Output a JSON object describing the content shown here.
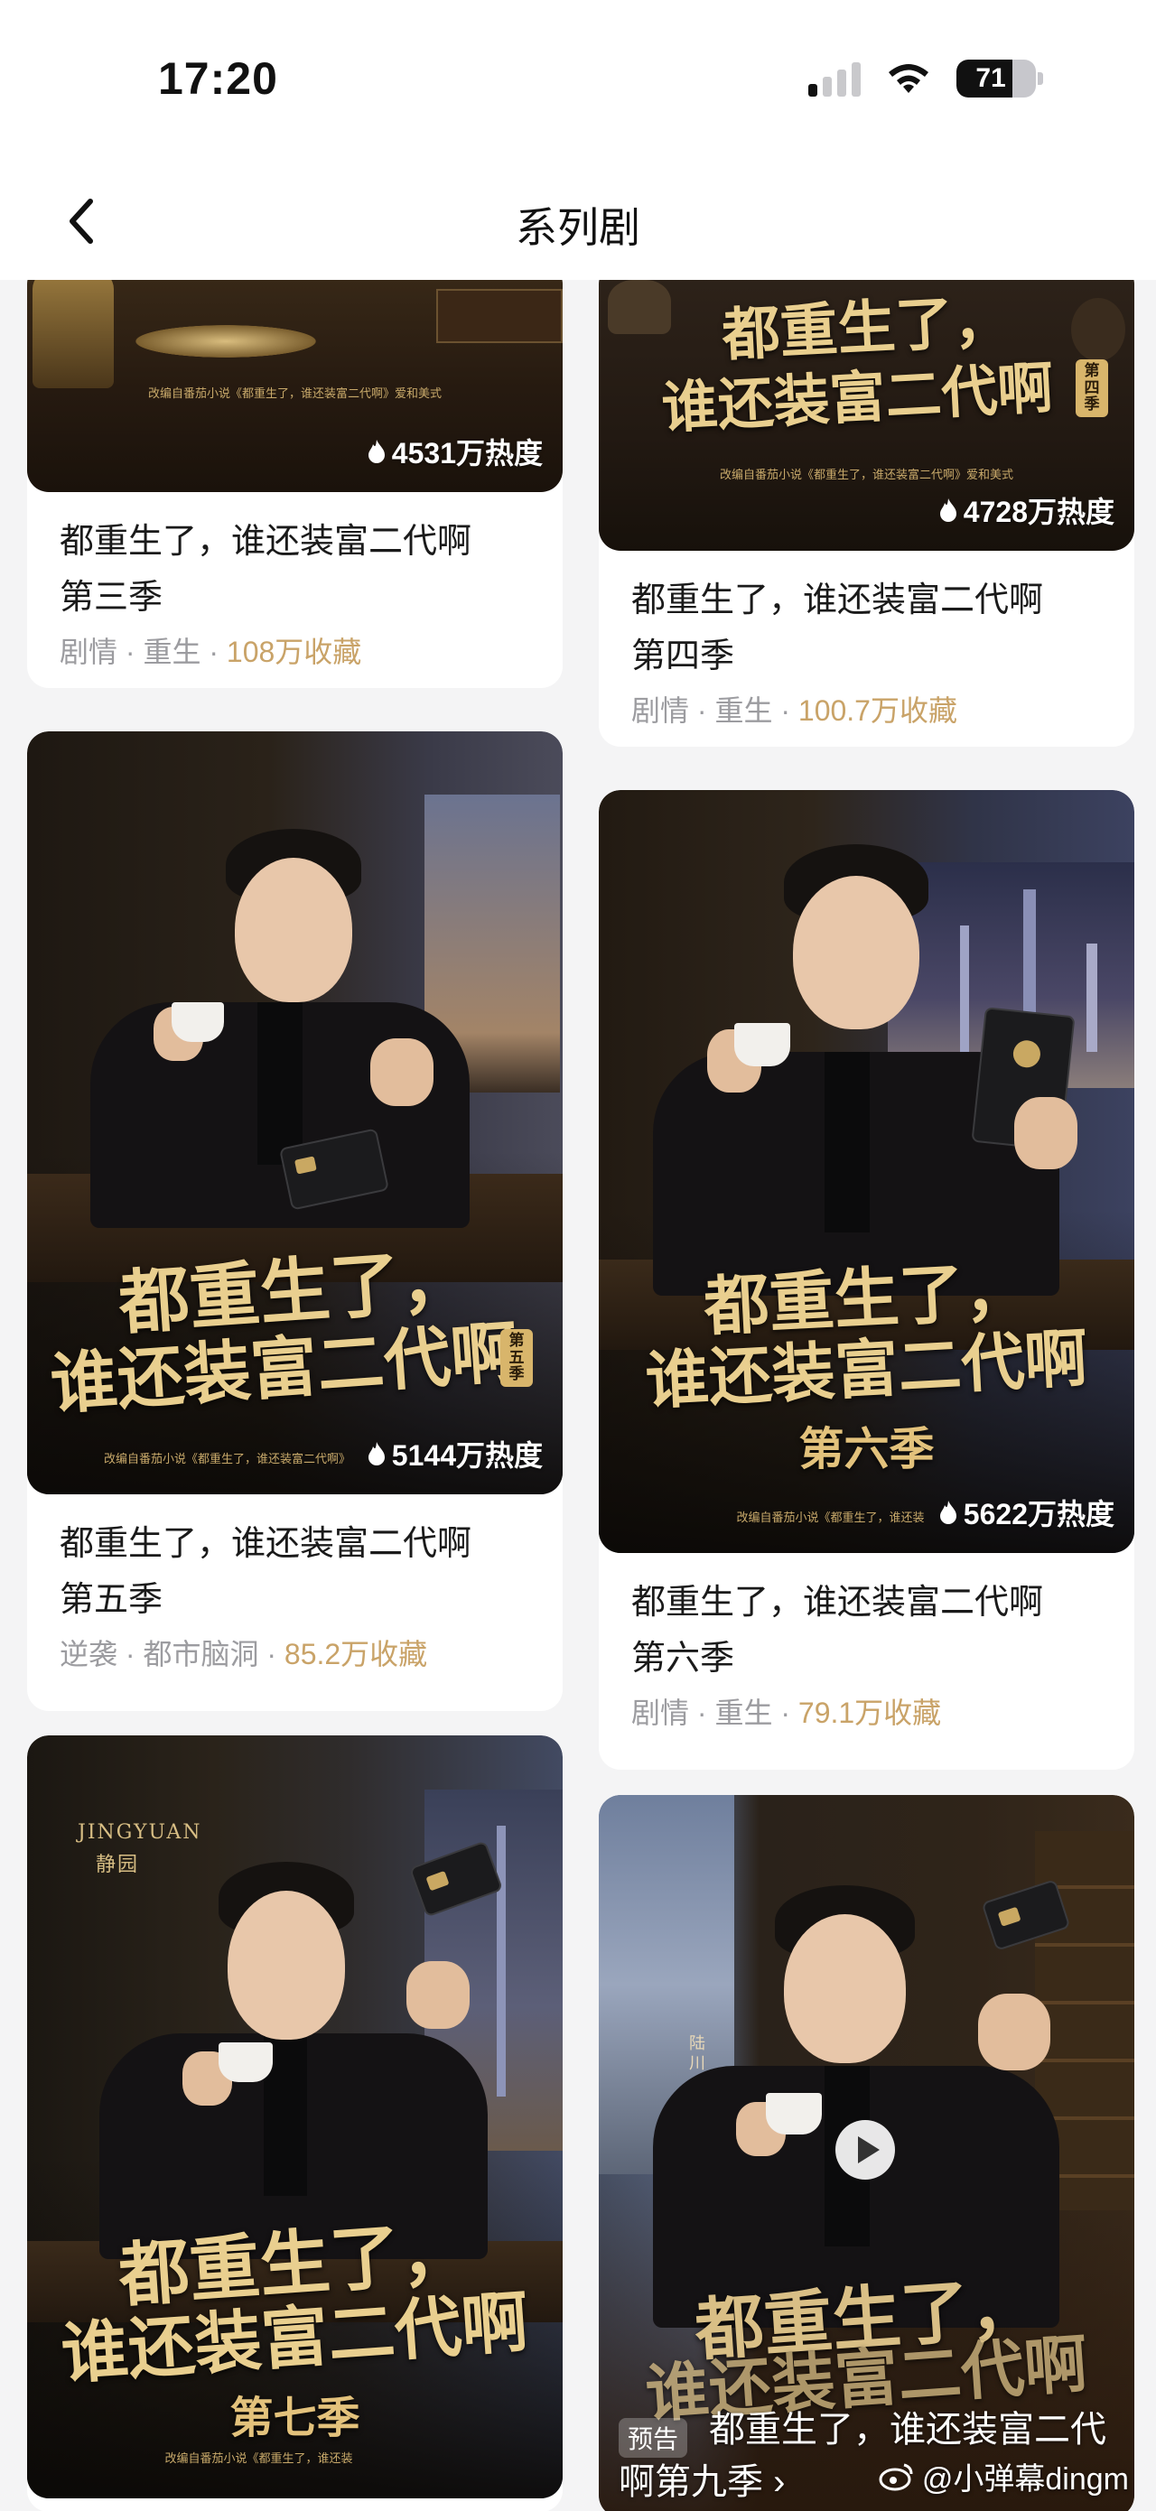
{
  "status_bar": {
    "time": "17:20",
    "battery": "71",
    "battery_level": 0.71
  },
  "nav": {
    "title": "系列剧"
  },
  "cards": [
    {
      "title_line1": "都重生了，谁还装富二代啊",
      "title_line2": "第三季",
      "tags": "剧情 · 重生 · ",
      "favorites": "108万收藏",
      "heat": "4531万热度",
      "caption": "改编自番茄小说《都重生了，谁还装富二代啊》爱和美式"
    },
    {
      "title_line1": "都重生了，谁还装富二代啊",
      "title_line2": "第四季",
      "tags": "剧情 · 重生 · ",
      "favorites": "100.7万收藏",
      "heat": "4728万热度",
      "poster_title_1": "都重生了，",
      "poster_title_2": "谁还装富二代啊",
      "badge": "第四季",
      "caption": "改编自番茄小说《都重生了，谁还装富二代啊》爱和美式"
    },
    {
      "title_line1": "都重生了，谁还装富二代啊",
      "title_line2": "第五季",
      "tags": "逆袭 · 都市脑洞 · ",
      "favorites": "85.2万收藏",
      "heat": "5144万热度",
      "poster_title_1": "都重生了，",
      "poster_title_2": "谁还装富二代啊",
      "badge": "第五季",
      "caption": "改编自番茄小说《都重生了，谁还装富二代啊》"
    },
    {
      "title_line1": "都重生了，谁还装富二代啊",
      "title_line2": "第六季",
      "tags": "剧情 · 重生 · ",
      "favorites": "79.1万收藏",
      "heat": "5622万热度",
      "poster_title_1": "都重生了，",
      "poster_title_2": "谁还装富二代啊",
      "poster_sub": "第六季",
      "caption": "改编自番茄小说《都重生了，谁还装"
    },
    {
      "poster_title_1": "都重生了，",
      "poster_title_2": "谁还装富二代啊",
      "poster_sub": "第七季",
      "brand_en": "JINGYUAN",
      "brand_cn": "静园",
      "caption": "改编自番茄小说《都重生了，谁还装"
    },
    {
      "preview_label": "预告",
      "preview_title": "都重生了，谁还装富二代啊第九季 ›",
      "poster_title_1": "都重生了，",
      "poster_title_2": "谁还装富二代啊",
      "side_text": "陆川"
    }
  ],
  "watermark": "@小弹幕dingm",
  "icons": {
    "back": "chevron-left-icon",
    "heat": "flame-icon",
    "wifi": "wifi-icon",
    "signal": "cellular-signal-icon",
    "battery": "battery-icon",
    "play": "play-icon",
    "weibo": "weibo-icon"
  },
  "colors": {
    "favorites": "#c9a368",
    "meta": "#9c9ca0",
    "poster_gold": "#e9cf8f"
  }
}
